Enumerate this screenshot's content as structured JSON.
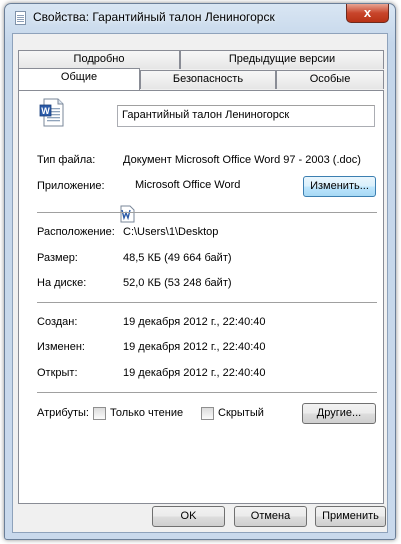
{
  "window": {
    "title": "Свойства: Гарантийный талон Лениногорск",
    "close_label": "x"
  },
  "tabs": {
    "row1": [
      "Подробно",
      "Предыдущие версии"
    ],
    "row2": [
      "Общие",
      "Безопасность",
      "Особые"
    ],
    "active": "Общие"
  },
  "general": {
    "file_name": "Гарантийный талон Лениногорск",
    "file_type_label": "Тип файла:",
    "file_type_value": "Документ Microsoft Office Word 97 - 2003 (.doc)",
    "app_label": "Приложение:",
    "app_value": "Microsoft Office Word",
    "change_button": "Изменить...",
    "location_label": "Расположение:",
    "location_value": "C:\\Users\\1\\Desktop",
    "size_label": "Размер:",
    "size_value": "48,5 КБ (49 664 байт)",
    "disk_label": "На диске:",
    "disk_value": "52,0 КБ (53 248 байт)",
    "created_label": "Создан:",
    "created_value": "19 декабря 2012 г., 22:40:40",
    "modified_label": "Изменен:",
    "modified_value": "19 декабря 2012 г., 22:40:40",
    "opened_label": "Открыт:",
    "opened_value": "19 декабря 2012 г., 22:40:40",
    "attributes_label": "Атрибуты:",
    "readonly_label": "Только чтение",
    "hidden_label": "Скрытый",
    "other_button": "Другие..."
  },
  "footer": {
    "ok": "OK",
    "cancel": "Отмена",
    "apply": "Применить"
  },
  "icons": {
    "title": "document-icon",
    "file": "word-document-icon",
    "app": "word-app-icon"
  }
}
